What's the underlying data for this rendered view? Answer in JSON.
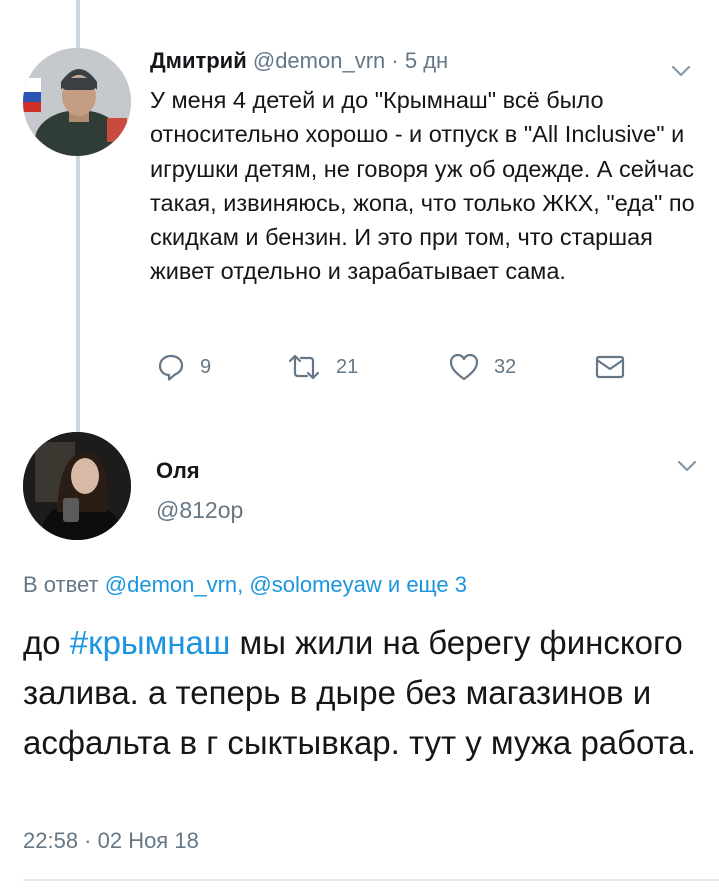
{
  "tweet1": {
    "author_name": "Дмитрий",
    "handle": "@demon_vrn",
    "separator": "·",
    "time": "5 дн",
    "text": "У меня 4 детей и до \"Крымнаш\" всё было относительно хорошо - и отпуск в \"All Inclusive\" и игрушки детям, не говоря уж об одежде. А сейчас такая, извиняюсь, жопа, что только ЖКХ, \"еда\" по скидкам и бензин. И это при том, что старшая живет отдельно и зарабатывает сама.",
    "replies": "9",
    "retweets": "21",
    "likes": "32"
  },
  "tweet2": {
    "author_name": "Оля",
    "handle": "@812op",
    "reply_prefix": "В ответ",
    "reply_user1": "@demon_vrn,",
    "reply_user2": "@solomeyaw",
    "reply_more": "и еще 3",
    "text_before": "до ",
    "hashtag": "#крымнаш",
    "text_after": " мы жили на берегу финского залива. а теперь в дыре без  магазинов и асфальта в г сыктывкар. тут у мужа работа.",
    "timestamp": "22:58 · 02 Ноя 18"
  },
  "colors": {
    "link": "#1b95e0",
    "secondary_text": "#657786",
    "primary_text": "#14171a",
    "thread_line": "#ccd6dd"
  },
  "icons": [
    "chevron-down-icon",
    "reply-icon",
    "retweet-icon",
    "like-icon",
    "direct-message-icon"
  ]
}
